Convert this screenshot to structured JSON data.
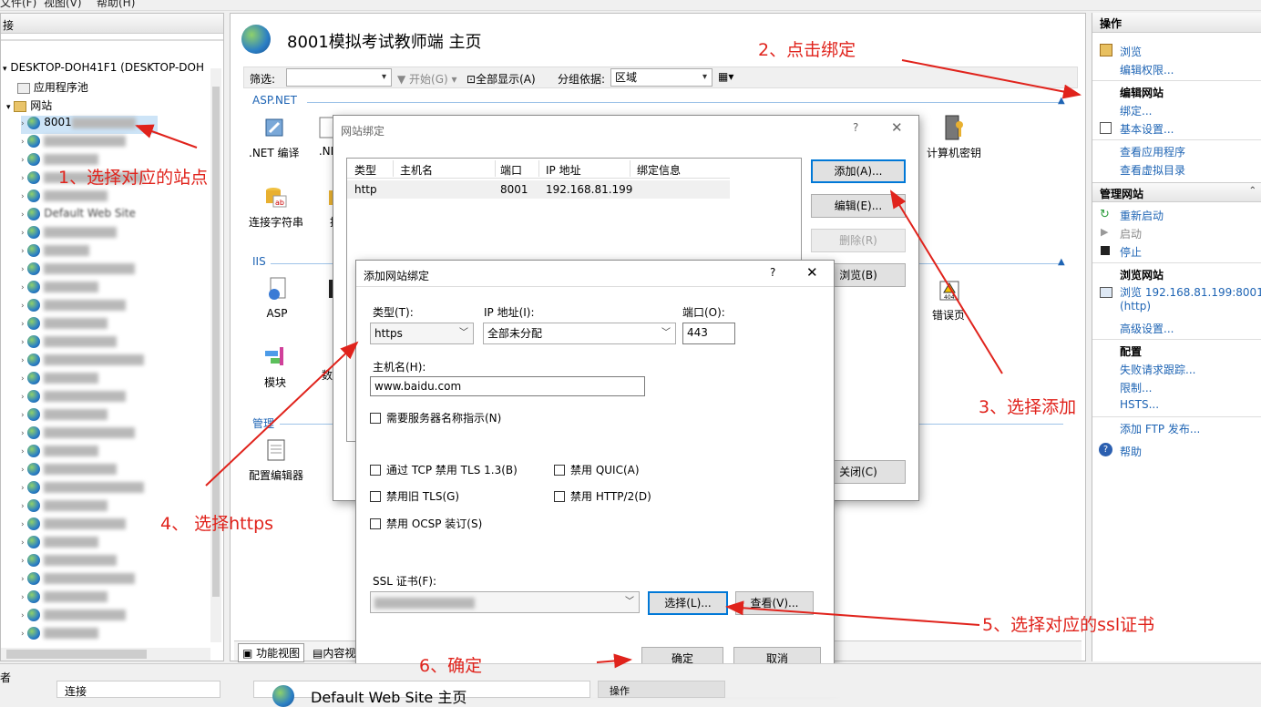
{
  "menubar": {
    "file": "文件(F)",
    "view": "视图(V)",
    "help": "帮助(H)"
  },
  "left": {
    "header": "接",
    "server": "DESKTOP-DOH41F1 (DESKTOP-DOH",
    "app_pools": "应用程序池",
    "sites": "网站",
    "selected_site": "8001",
    "default_site": "Default Web Site"
  },
  "center": {
    "title": "8001模拟考试教师端 主页",
    "filter_label": "筛选:",
    "start_label": "开始(G)",
    "showall_label": "全部显示(A)",
    "groupby_label": "分组依据:",
    "groupby_value": "区域",
    "section_aspnet": "ASP.NET",
    "section_iis": "IIS",
    "section_manage": "管理",
    "features": {
      "net_compile": ".NET 编译",
      "net_other": ".NE",
      "conn_strings": "连接字符串",
      "ti": "提",
      "asp": "ASP",
      "modules": "模块",
      "shu": "数",
      "config_editor": "配置编辑器",
      "machine_key": "计算机密钥",
      "error_pages": "错误页"
    },
    "view_tab_features": "功能视图",
    "view_tab_content": "内容视"
  },
  "right": {
    "header": "操作",
    "browse": "浏览",
    "edit_perms": "编辑权限...",
    "edit_site_head": "编辑网站",
    "bindings": "绑定...",
    "basic_settings": "基本设置...",
    "view_apps": "查看应用程序",
    "view_vdirs": "查看虚拟目录",
    "manage_site": "管理网站",
    "restart": "重新启动",
    "start": "启动",
    "stop": "停止",
    "browse_site_head": "浏览网站",
    "browse_url": "浏览 192.168.81.199:8001",
    "browse_proto": "(http)",
    "advanced": "高级设置...",
    "config_head": "配置",
    "failed_req": "失败请求跟踪...",
    "limits": "限制...",
    "hsts": "HSTS...",
    "add_ftp": "添加 FTP 发布...",
    "help": "帮助"
  },
  "site_bindings": {
    "title": "网站绑定",
    "help_mark": "?",
    "columns": [
      "类型",
      "主机名",
      "端口",
      "IP 地址",
      "绑定信息"
    ],
    "rows": [
      [
        "http",
        "",
        "8001",
        "192.168.81.199",
        ""
      ]
    ],
    "add": "添加(A)...",
    "edit": "编辑(E)...",
    "remove": "删除(R)",
    "browse": "浏览(B)",
    "close": "关闭(C)"
  },
  "add_binding": {
    "title": "添加网站绑定",
    "help_mark": "?",
    "type_label": "类型(T):",
    "type_value": "https",
    "ip_label": "IP 地址(I):",
    "ip_value": "全部未分配",
    "port_label": "端口(O):",
    "port_value": "443",
    "host_label": "主机名(H):",
    "host_value": "www.baidu.com",
    "sni": "需要服务器名称指示(N)",
    "disable_tls13": "通过 TCP 禁用 TLS 1.3(B)",
    "disable_quic": "禁用 QUIC(A)",
    "disable_legacy_tls": "禁用旧 TLS(G)",
    "disable_http2": "禁用 HTTP/2(D)",
    "disable_ocsp": "禁用 OCSP 装订(S)",
    "ssl_label": "SSL 证书(F):",
    "select": "选择(L)...",
    "view": "查看(V)...",
    "ok": "确定",
    "cancel": "取消"
  },
  "annotations": {
    "a1": "1、选择对应的站点",
    "a2": "2、点击绑定",
    "a3": "3、选择添加",
    "a4": "4、 选择https",
    "a5": "5、选择对应的ssl证书",
    "a6": "6、确定"
  },
  "bottom": {
    "left_text": "者",
    "tab2": "连接",
    "default_title": "Default Web Site 主页",
    "right_head": "操作"
  },
  "colors": {
    "accent": "#0078d7",
    "link": "#1e64b4",
    "annotation": "#e0231c"
  }
}
